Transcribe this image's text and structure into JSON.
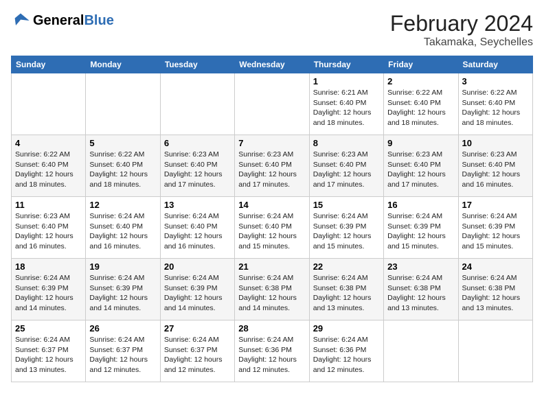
{
  "header": {
    "logo_general": "General",
    "logo_blue": "Blue",
    "month_year": "February 2024",
    "location": "Takamaka, Seychelles"
  },
  "days_of_week": [
    "Sunday",
    "Monday",
    "Tuesday",
    "Wednesday",
    "Thursday",
    "Friday",
    "Saturday"
  ],
  "weeks": [
    [
      {
        "day": "",
        "info": ""
      },
      {
        "day": "",
        "info": ""
      },
      {
        "day": "",
        "info": ""
      },
      {
        "day": "",
        "info": ""
      },
      {
        "day": "1",
        "info": "Sunrise: 6:21 AM\nSunset: 6:40 PM\nDaylight: 12 hours and 18 minutes."
      },
      {
        "day": "2",
        "info": "Sunrise: 6:22 AM\nSunset: 6:40 PM\nDaylight: 12 hours and 18 minutes."
      },
      {
        "day": "3",
        "info": "Sunrise: 6:22 AM\nSunset: 6:40 PM\nDaylight: 12 hours and 18 minutes."
      }
    ],
    [
      {
        "day": "4",
        "info": "Sunrise: 6:22 AM\nSunset: 6:40 PM\nDaylight: 12 hours and 18 minutes."
      },
      {
        "day": "5",
        "info": "Sunrise: 6:22 AM\nSunset: 6:40 PM\nDaylight: 12 hours and 18 minutes."
      },
      {
        "day": "6",
        "info": "Sunrise: 6:23 AM\nSunset: 6:40 PM\nDaylight: 12 hours and 17 minutes."
      },
      {
        "day": "7",
        "info": "Sunrise: 6:23 AM\nSunset: 6:40 PM\nDaylight: 12 hours and 17 minutes."
      },
      {
        "day": "8",
        "info": "Sunrise: 6:23 AM\nSunset: 6:40 PM\nDaylight: 12 hours and 17 minutes."
      },
      {
        "day": "9",
        "info": "Sunrise: 6:23 AM\nSunset: 6:40 PM\nDaylight: 12 hours and 17 minutes."
      },
      {
        "day": "10",
        "info": "Sunrise: 6:23 AM\nSunset: 6:40 PM\nDaylight: 12 hours and 16 minutes."
      }
    ],
    [
      {
        "day": "11",
        "info": "Sunrise: 6:23 AM\nSunset: 6:40 PM\nDaylight: 12 hours and 16 minutes."
      },
      {
        "day": "12",
        "info": "Sunrise: 6:24 AM\nSunset: 6:40 PM\nDaylight: 12 hours and 16 minutes."
      },
      {
        "day": "13",
        "info": "Sunrise: 6:24 AM\nSunset: 6:40 PM\nDaylight: 12 hours and 16 minutes."
      },
      {
        "day": "14",
        "info": "Sunrise: 6:24 AM\nSunset: 6:40 PM\nDaylight: 12 hours and 15 minutes."
      },
      {
        "day": "15",
        "info": "Sunrise: 6:24 AM\nSunset: 6:39 PM\nDaylight: 12 hours and 15 minutes."
      },
      {
        "day": "16",
        "info": "Sunrise: 6:24 AM\nSunset: 6:39 PM\nDaylight: 12 hours and 15 minutes."
      },
      {
        "day": "17",
        "info": "Sunrise: 6:24 AM\nSunset: 6:39 PM\nDaylight: 12 hours and 15 minutes."
      }
    ],
    [
      {
        "day": "18",
        "info": "Sunrise: 6:24 AM\nSunset: 6:39 PM\nDaylight: 12 hours and 14 minutes."
      },
      {
        "day": "19",
        "info": "Sunrise: 6:24 AM\nSunset: 6:39 PM\nDaylight: 12 hours and 14 minutes."
      },
      {
        "day": "20",
        "info": "Sunrise: 6:24 AM\nSunset: 6:39 PM\nDaylight: 12 hours and 14 minutes."
      },
      {
        "day": "21",
        "info": "Sunrise: 6:24 AM\nSunset: 6:38 PM\nDaylight: 12 hours and 14 minutes."
      },
      {
        "day": "22",
        "info": "Sunrise: 6:24 AM\nSunset: 6:38 PM\nDaylight: 12 hours and 13 minutes."
      },
      {
        "day": "23",
        "info": "Sunrise: 6:24 AM\nSunset: 6:38 PM\nDaylight: 12 hours and 13 minutes."
      },
      {
        "day": "24",
        "info": "Sunrise: 6:24 AM\nSunset: 6:38 PM\nDaylight: 12 hours and 13 minutes."
      }
    ],
    [
      {
        "day": "25",
        "info": "Sunrise: 6:24 AM\nSunset: 6:37 PM\nDaylight: 12 hours and 13 minutes."
      },
      {
        "day": "26",
        "info": "Sunrise: 6:24 AM\nSunset: 6:37 PM\nDaylight: 12 hours and 12 minutes."
      },
      {
        "day": "27",
        "info": "Sunrise: 6:24 AM\nSunset: 6:37 PM\nDaylight: 12 hours and 12 minutes."
      },
      {
        "day": "28",
        "info": "Sunrise: 6:24 AM\nSunset: 6:36 PM\nDaylight: 12 hours and 12 minutes."
      },
      {
        "day": "29",
        "info": "Sunrise: 6:24 AM\nSunset: 6:36 PM\nDaylight: 12 hours and 12 minutes."
      },
      {
        "day": "",
        "info": ""
      },
      {
        "day": "",
        "info": ""
      }
    ]
  ]
}
